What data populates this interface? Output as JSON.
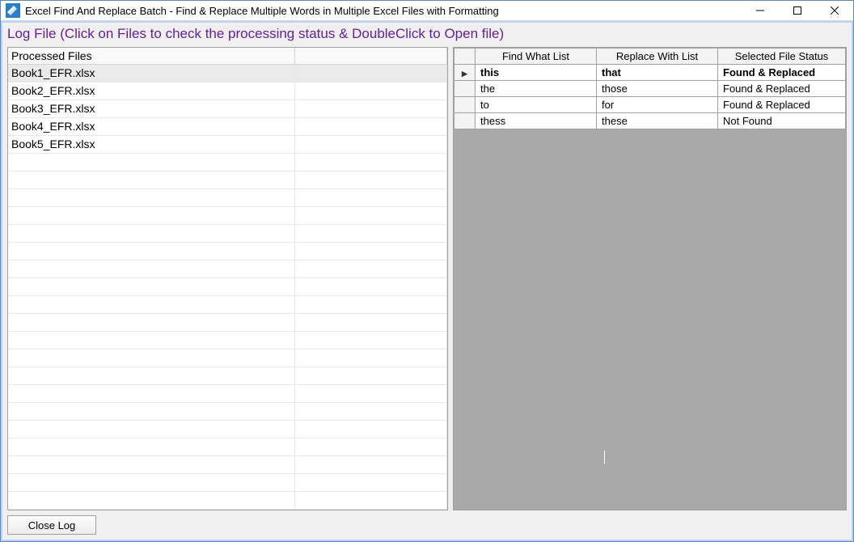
{
  "window": {
    "title": "Excel Find And Replace Batch - Find & Replace Multiple Words in Multiple Excel Files with Formatting"
  },
  "headerbar": {
    "text": "Log File (Click on Files to check the processing status & DoubleClick to Open file)"
  },
  "files_grid": {
    "header": "Processed Files",
    "rows": [
      {
        "name": "Book1_EFR.xlsx",
        "selected": true
      },
      {
        "name": "Book2_EFR.xlsx",
        "selected": false
      },
      {
        "name": "Book3_EFR.xlsx",
        "selected": false
      },
      {
        "name": "Book4_EFR.xlsx",
        "selected": false
      },
      {
        "name": "Book5_EFR.xlsx",
        "selected": false
      }
    ],
    "empty_rows": 20
  },
  "results_grid": {
    "columns": [
      "Find What List",
      "Replace With List",
      "Selected File Status"
    ],
    "rows": [
      {
        "find": "this",
        "replace": "that",
        "status": "Found & Replaced",
        "selected": true
      },
      {
        "find": "the",
        "replace": "those",
        "status": "Found & Replaced",
        "selected": false
      },
      {
        "find": "to",
        "replace": "for",
        "status": "Found & Replaced",
        "selected": false
      },
      {
        "find": "thess",
        "replace": "these",
        "status": "Not Found",
        "selected": false
      }
    ]
  },
  "buttons": {
    "close_log": "Close Log"
  }
}
